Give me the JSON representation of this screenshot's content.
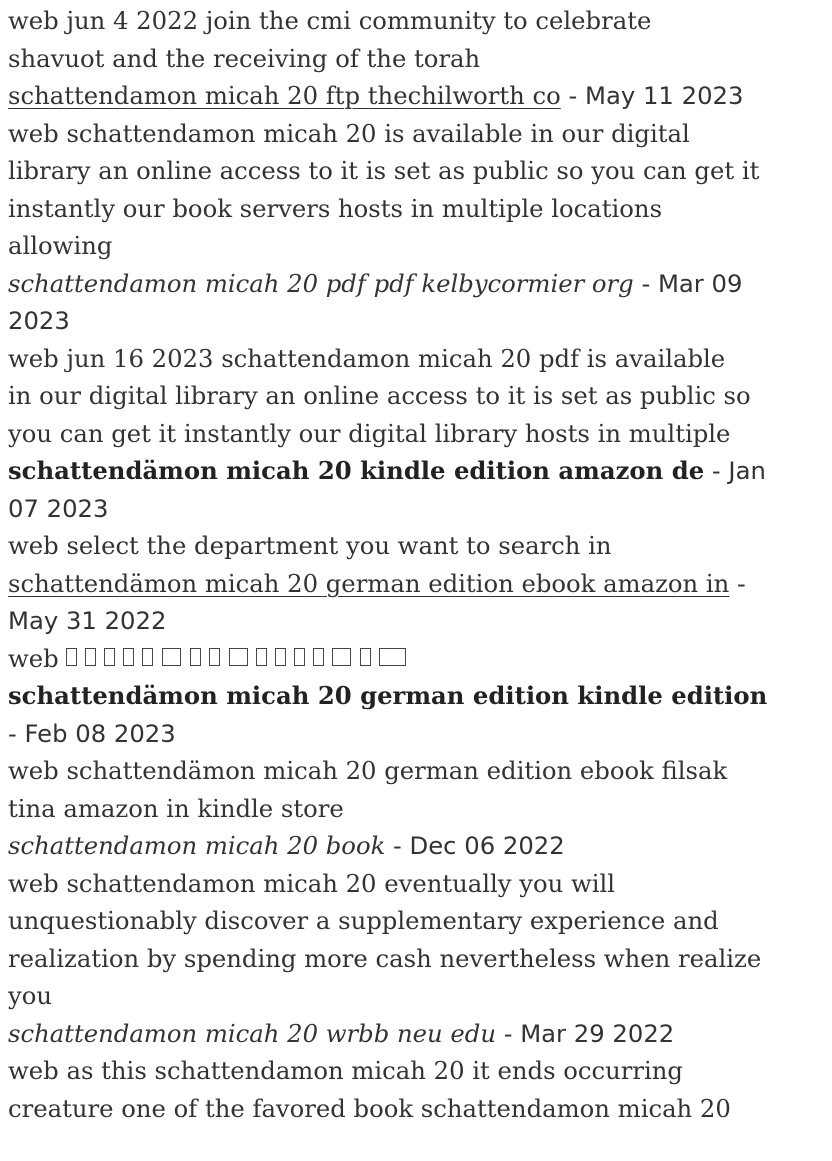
{
  "items": [
    {
      "snippet_head": [
        "web jun 4 2022   join the cmi community to celebrate",
        "shavuot and the receiving of the torah"
      ]
    },
    {
      "title": "schattendamon micah 20 ftp thechilworth co",
      "date": " - May 11 2023",
      "snippet": [
        "web schattendamon micah 20 is available in our digital",
        "library an online access to it is set as public so you can get it",
        "instantly our book servers hosts in multiple locations",
        "allowing"
      ]
    },
    {
      "title": "schattendamon micah 20 pdf pdf kelbycormier org",
      "date_a": " - Mar 09",
      "date_b": "2023",
      "snippet": [
        "web jun 16 2023   schattendamon micah 20 pdf is available",
        "in our digital library an online access to it is set as public so",
        "you can get it instantly our digital library hosts in multiple"
      ]
    },
    {
      "title": "schattendämon micah 20 kindle edition amazon de",
      "date_a": " - Jan",
      "date_b": "07 2023",
      "snippet": [
        "web select the department you want to search in"
      ]
    },
    {
      "title": "schattendämon micah 20 german edition ebook amazon in",
      "date_a": " -",
      "date_b": "May 31 2022",
      "snippet_prefix": "web "
    },
    {
      "title": "schattendämon micah 20 german edition kindle edition",
      "date": "- Feb 08 2023",
      "snippet": [
        "web schattendämon micah 20 german edition ebook filsak",
        "tina amazon in kindle store"
      ]
    },
    {
      "title": "schattendamon micah 20 book",
      "date": " - Dec 06 2022",
      "snippet": [
        "web schattendamon micah 20 eventually you will",
        "unquestionably discover a supplementary experience and",
        "realization by spending more cash nevertheless when realize",
        "you"
      ]
    },
    {
      "title": "schattendamon micah 20 wrbb neu edu",
      "date": " - Mar 29 2022",
      "snippet": [
        "web as this schattendamon micah 20 it ends occurring",
        "creature one of the favored book schattendamon micah 20"
      ]
    }
  ]
}
